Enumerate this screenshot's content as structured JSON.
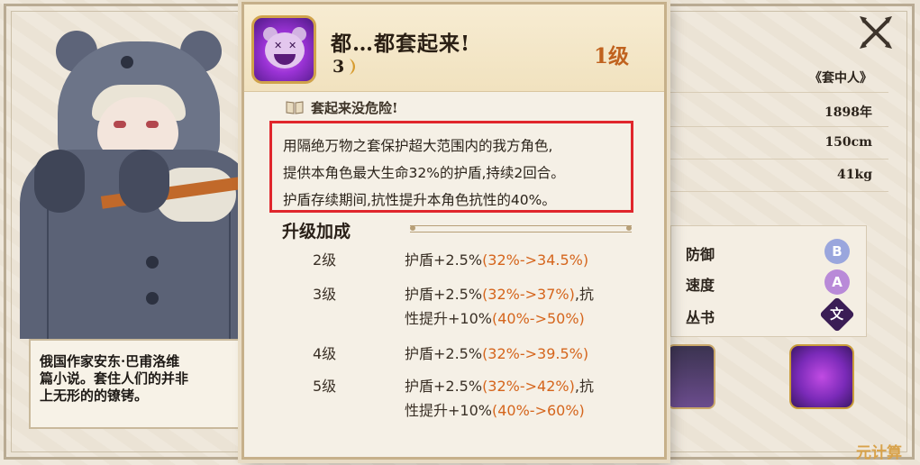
{
  "popup": {
    "skill_name": "都…都套起来!",
    "skill_cost": "3",
    "skill_level": "1级",
    "subtitle": "套起来没危险!",
    "description": [
      "用隔绝万物之套保护超大范围内的我方角色,",
      "提供本角色最大生命32%的护盾,持续2回合。",
      "护盾存续期间,抗性提升本角色抗性的40%。"
    ],
    "upgrade_title": "升级加成",
    "levels": [
      {
        "label": "2级",
        "line1_prefix": "护盾+2.5%",
        "line1_paren": "(32%->34.5%)",
        "line1_suffix": "",
        "line2_prefix": "",
        "line2_paren": ""
      },
      {
        "label": "3级",
        "line1_prefix": "护盾+2.5%",
        "line1_paren": "(32%->37%)",
        "line1_suffix": ",抗",
        "line2_prefix": "性提升+10%",
        "line2_paren": "(40%->50%)"
      },
      {
        "label": "4级",
        "line1_prefix": "护盾+2.5%",
        "line1_paren": "(32%->39.5%)",
        "line1_suffix": "",
        "line2_prefix": "",
        "line2_paren": ""
      },
      {
        "label": "5级",
        "line1_prefix": "护盾+2.5%",
        "line1_paren": "(32%->42%)",
        "line1_suffix": ",抗",
        "line2_prefix": "性提升+10%",
        "line2_paren": "(40%->60%)"
      }
    ]
  },
  "info": {
    "name": "《套中人》",
    "year": "1898年",
    "height": "150cm",
    "weight": "41kg"
  },
  "attributes": [
    {
      "label": "防御",
      "grade": "B",
      "color": "#9aa6dd"
    },
    {
      "label": "速度",
      "grade": "A",
      "color": "#b98ad8"
    },
    {
      "label": "丛书",
      "grade": "文",
      "color": "#3a1d55"
    }
  ],
  "bio": "俄国作家安东·巴甫洛维\n篇小说。套住人们的并非\n上无形的的镣铐。",
  "watermark": "元计算",
  "colors": {
    "accent_orange": "#d5651c",
    "highlight_red": "#e0262c",
    "level_orange": "#c0621e"
  }
}
